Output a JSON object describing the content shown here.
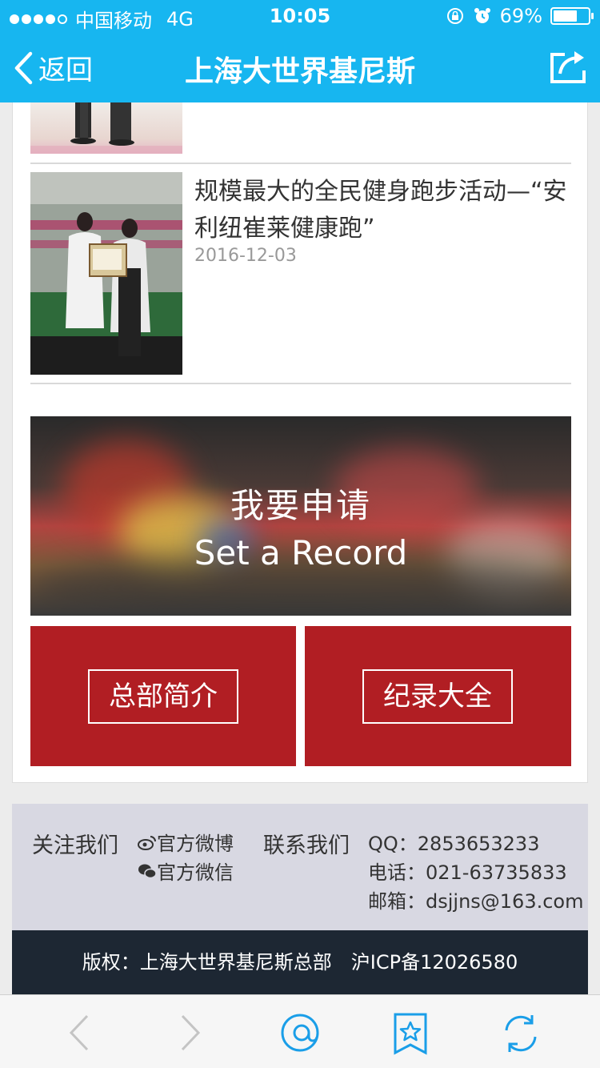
{
  "statusbar": {
    "carrier": "中国移动",
    "network": "4G",
    "time": "10:05",
    "battery": "69%",
    "battery_level": 0.69,
    "signal_bars": 4
  },
  "navbar": {
    "back_label": "返回",
    "title": "上海大世界基尼斯"
  },
  "news": {
    "title": "规模最大的全民健身跑步活动—“安利纽崔莱健康跑”",
    "date": "2016-12-03"
  },
  "banner": {
    "title_cn": "我要申请",
    "title_en": "Set a Record"
  },
  "buttons": {
    "about": "总部简介",
    "records": "纪录大全"
  },
  "footer": {
    "follow_label": "关注我们",
    "weibo": "官方微博",
    "wechat": "官方微信",
    "contact_label": "联系我们",
    "qq": "QQ：2853653233",
    "phone": "电话：021-63735833",
    "email": "邮箱：dsjjns@163.com",
    "copyright": "版权：上海大世界基尼斯总部　沪ICP备12026580"
  },
  "colors": {
    "header_blue": "#17b6f0",
    "button_red": "#b11e23",
    "footer_dark": "#1d2733",
    "toolbar_icon_blue": "#1a9ee8"
  },
  "toolbar_icons": [
    "back-arrow-icon",
    "forward-arrow-icon",
    "chat-bubble-icon",
    "bookmark-star-icon",
    "refresh-icon"
  ]
}
